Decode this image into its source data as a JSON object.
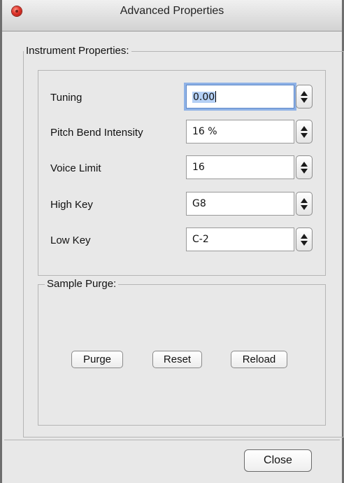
{
  "window": {
    "title": "Advanced Properties"
  },
  "instrument": {
    "group_label": "Instrument Properties:",
    "properties": [
      {
        "label": "Tuning",
        "value_selected": "0.00",
        "value": ""
      },
      {
        "label": "Pitch Bend Intensity",
        "value": "16 %"
      },
      {
        "label": "Voice Limit",
        "value": "16"
      },
      {
        "label": "High Key",
        "value": "G8"
      },
      {
        "label": "Low Key",
        "value": "C-2"
      }
    ]
  },
  "sample_purge": {
    "group_label": "Sample Purge:",
    "buttons": [
      "Purge",
      "Reset",
      "Reload"
    ]
  },
  "footer": {
    "close_label": "Close"
  }
}
